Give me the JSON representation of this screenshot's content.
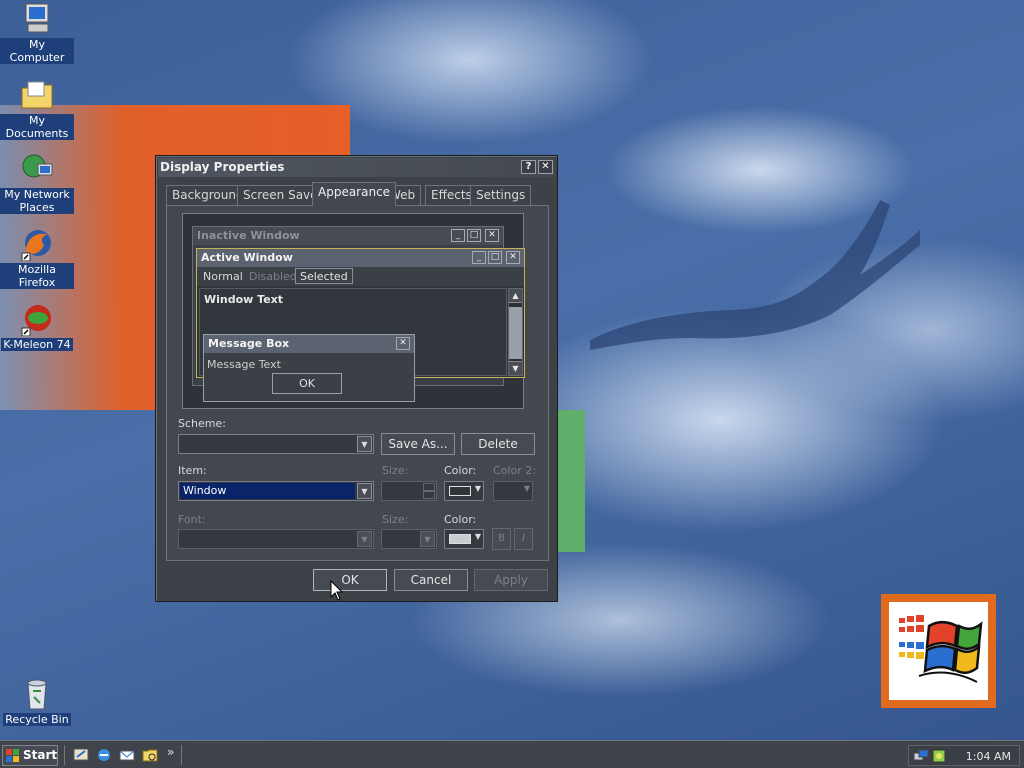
{
  "desktop_icons": [
    {
      "label": "My Computer",
      "icon": "my-computer-icon"
    },
    {
      "label": "My Documents",
      "icon": "my-documents-icon"
    },
    {
      "label_line1": "My Network",
      "label_line2": "Places",
      "icon": "network-places-icon"
    },
    {
      "label": "Mozilla Firefox",
      "icon": "firefox-icon"
    },
    {
      "label": "K-Meleon 74",
      "icon": "k-meleon-icon"
    },
    {
      "label": "Recycle Bin",
      "icon": "recycle-bin-icon"
    }
  ],
  "dialog": {
    "title": "Display Properties",
    "help_label": "?",
    "close_label": "✕",
    "tabs": [
      "Background",
      "Screen Saver",
      "Appearance",
      "Web",
      "Effects",
      "Settings"
    ],
    "active_tab": "Appearance",
    "preview": {
      "inactive_title": "Inactive Window",
      "active_title": "Active Window",
      "menu_normal": "Normal",
      "menu_disabled": "Disabled",
      "menu_selected": "Selected",
      "window_text": "Window Text",
      "msgbox_title": "Message Box",
      "msgbox_text": "Message Text",
      "msgbox_ok": "OK"
    },
    "scheme_label": "Scheme:",
    "scheme_value": "",
    "save_as_label": "Save As...",
    "delete_label": "Delete",
    "item_label": "Item:",
    "item_value": "Window",
    "size_label": "Size:",
    "color_label": "Color:",
    "color2_label": "Color 2:",
    "font_label": "Font:",
    "font_size_label": "Size:",
    "font_color_label": "Color:",
    "bold_label": "B",
    "italic_label": "I",
    "ok_label": "OK",
    "cancel_label": "Cancel",
    "apply_label": "Apply"
  },
  "taskbar": {
    "start_label": "Start",
    "chevron": "»",
    "clock": "1:04 AM"
  },
  "colors": {
    "dialog_bg": "#3d4148",
    "active_title": "#5b6270",
    "selection": "#0a246a",
    "wallpaper_orange": "#e85f28",
    "wallpaper_blue": "#4a6fa8"
  }
}
